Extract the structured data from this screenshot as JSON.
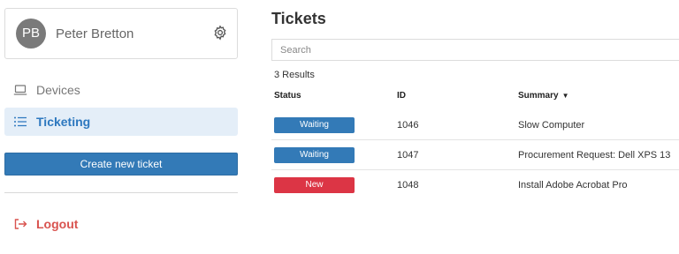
{
  "user": {
    "initials": "PB",
    "name": "Peter Bretton"
  },
  "nav": [
    {
      "label": "Devices",
      "icon": "laptop-icon"
    },
    {
      "label": "Ticketing",
      "icon": "list-icon",
      "active": true
    }
  ],
  "create_button": "Create new ticket",
  "logout_label": "Logout",
  "main": {
    "title": "Tickets",
    "search_placeholder": "Search",
    "results_text": "3 Results",
    "columns": {
      "status": "Status",
      "id": "ID",
      "summary": "Summary"
    },
    "rows": [
      {
        "status": "Waiting",
        "id": "1046",
        "summary": "Slow Computer"
      },
      {
        "status": "Waiting",
        "id": "1047",
        "summary": "Procurement Request: Dell XPS 13"
      },
      {
        "status": "New",
        "id": "1048",
        "summary": "Install Adobe Acrobat Pro"
      }
    ]
  },
  "colors": {
    "accent": "#337ab7",
    "active_bg": "#e4eef8",
    "status_waiting": "#337ab7",
    "status_new": "#dc3545",
    "logout": "#d9534f"
  }
}
